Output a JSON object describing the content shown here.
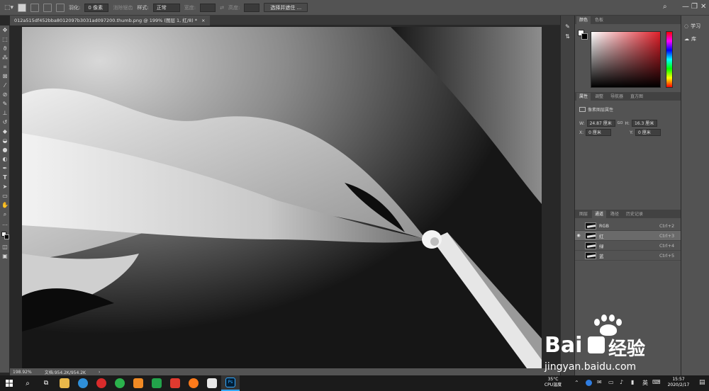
{
  "options_bar": {
    "feather_label": "羽化:",
    "feather_value": "0 像素",
    "antialias_label": "消除锯齿",
    "style_label": "样式:",
    "style_value": "正常",
    "width_label": "宽度:",
    "height_label": "高度:",
    "select_mask_button": "选择并遮住 ..."
  },
  "document_tab": {
    "title": "012a515df452bba8012097b3031ad097200.thumb.png @ 199% (图层 1, 红/8) *",
    "close": "×"
  },
  "status_bar": {
    "zoom": "198.92%",
    "doc_info": "文档:954.2K/954.2K",
    "arrow": "›"
  },
  "color_panel": {
    "tabs": [
      "颜色",
      "色板"
    ]
  },
  "properties_panel": {
    "tabs": [
      "属性",
      "调整",
      "导航器",
      "直方图"
    ],
    "layer_type": "像素图层属性",
    "w_label": "W:",
    "w_value": "24.87 厘米",
    "link_icon": "GO",
    "h_label": "H:",
    "h_value": "16.3 厘米",
    "x_label": "X:",
    "x_value": "0 厘米",
    "y_label": "Y:",
    "y_value": "0 厘米"
  },
  "channels_panel": {
    "tabs": [
      "图层",
      "通道",
      "路径",
      "历史记录"
    ],
    "channels": [
      {
        "name": "RGB",
        "shortcut": "Ctrl+2",
        "visible": false,
        "selected": false
      },
      {
        "name": "红",
        "shortcut": "Ctrl+3",
        "visible": true,
        "selected": true
      },
      {
        "name": "绿",
        "shortcut": "Ctrl+4",
        "visible": false,
        "selected": false
      },
      {
        "name": "蓝",
        "shortcut": "Ctrl+5",
        "visible": false,
        "selected": false
      }
    ]
  },
  "learn_panel": {
    "learn_label": "学习",
    "library_label": "库"
  },
  "window_controls": {
    "minimize": "—",
    "restore": "❐",
    "close": "✕"
  },
  "watermark": {
    "brand_latin": "Bai",
    "brand_cn": "经验",
    "url": "jingyan.baidu.com"
  },
  "taskbar": {
    "temp": "35°C",
    "temp_label": "CPU温度",
    "ime": "英",
    "time": "15:57",
    "date": "2020/2/17"
  },
  "colors": {
    "ps_bg": "#535353",
    "ps_dark": "#282828",
    "accent_ps": "#31a8ff",
    "taskbar": "#1b1b1b"
  }
}
